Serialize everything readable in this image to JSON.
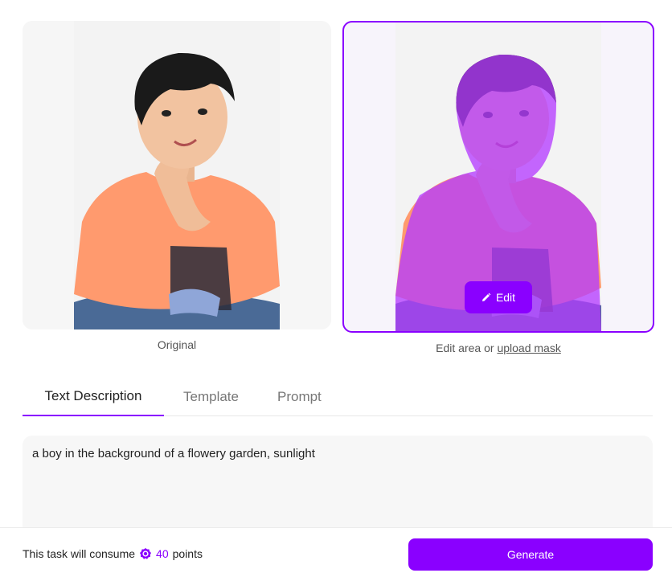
{
  "images": {
    "original_caption": "Original",
    "edit_caption_prefix": "Edit area or",
    "edit_caption_link": "upload mask",
    "edit_button_label": "Edit"
  },
  "tabs": [
    {
      "label": "Text Description",
      "active": true
    },
    {
      "label": "Template",
      "active": false
    },
    {
      "label": "Prompt",
      "active": false
    }
  ],
  "description": {
    "value": "a boy in the background of a flowery garden, sunlight"
  },
  "footer": {
    "consume_prefix": "This task will consume",
    "points": "40",
    "consume_suffix": "points",
    "generate_label": "Generate"
  },
  "colors": {
    "accent": "#8a00ff"
  }
}
